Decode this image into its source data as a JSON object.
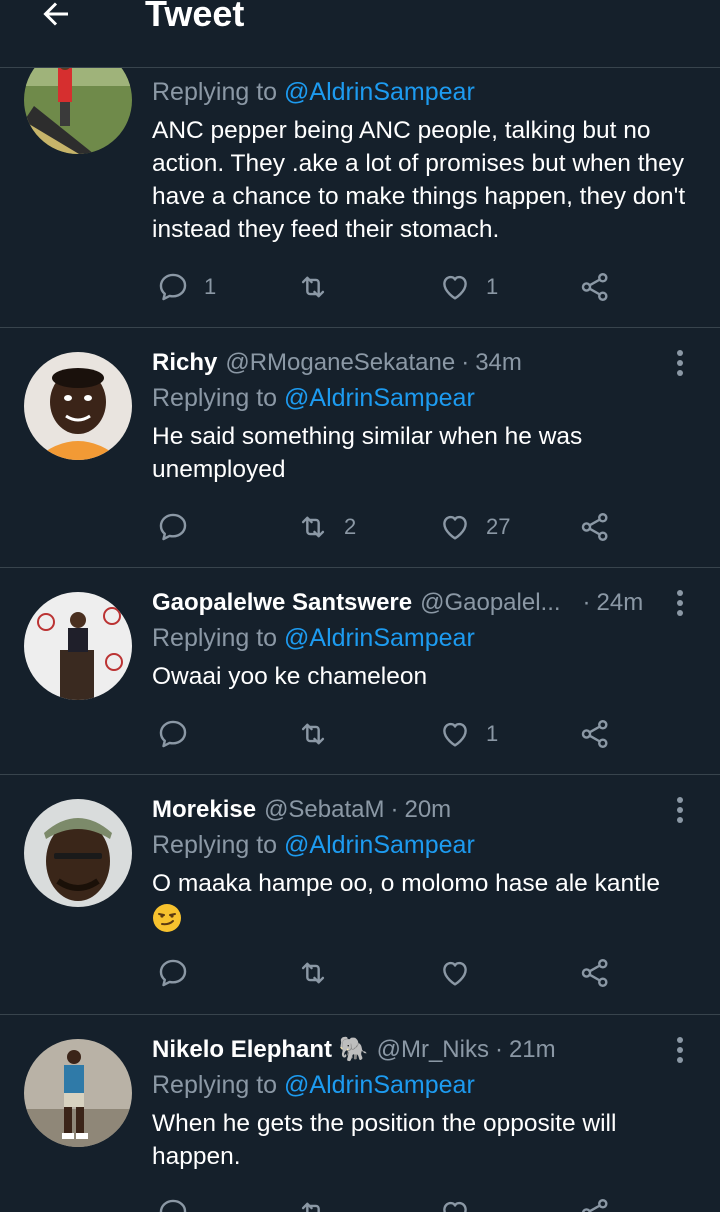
{
  "header": {
    "title": "Tweet"
  },
  "tweets": [
    {
      "name": "",
      "handle": "",
      "time": "",
      "replying_prefix": "Replying to ",
      "replying_to": "@AldrinSampear",
      "text": "ANC pepper being ANC people,  talking but no action. They .ake a lot of promises but when they have a chance to make things happen, they don't instead they feed their stomach.",
      "replies": "1",
      "retweets": "",
      "likes": "1"
    },
    {
      "name": "Richy",
      "handle": "@RMoganeSekatane",
      "time": "34m",
      "replying_prefix": "Replying to ",
      "replying_to": "@AldrinSampear",
      "text": "He said something similar when he was unemployed",
      "replies": "",
      "retweets": "2",
      "likes": "27"
    },
    {
      "name": "Gaopalelwe Santswere",
      "handle": "@Gaopalel...",
      "time": "24m",
      "replying_prefix": "Replying to ",
      "replying_to": "@AldrinSampear",
      "text": "Owaai yoo ke chameleon",
      "replies": "",
      "retweets": "",
      "likes": "1"
    },
    {
      "name": "Morekise",
      "handle": "@SebataM",
      "time": "20m",
      "replying_prefix": "Replying to ",
      "replying_to": "@AldrinSampear",
      "text": "O maaka hampe oo, o molomo hase ale kantle",
      "emoji": "smirking-face-emoji",
      "replies": "",
      "retweets": "",
      "likes": ""
    },
    {
      "name": "Nikelo Elephant 🐘",
      "handle": "@Mr_Niks",
      "time": "21m",
      "replying_prefix": "Replying to ",
      "replying_to": "@AldrinSampear",
      "text": "When he gets the position the opposite will happen.",
      "replies": "",
      "retweets": "",
      "likes": ""
    }
  ],
  "icons": {
    "back": "arrow-left-icon",
    "reply": "reply-icon",
    "retweet": "retweet-icon",
    "like": "heart-icon",
    "share": "share-icon",
    "more": "more-vertical-icon"
  },
  "colors": {
    "background": "#15202b",
    "divider": "#38444d",
    "secondary_text": "#8b98a5",
    "mention": "#1d9bf0"
  }
}
